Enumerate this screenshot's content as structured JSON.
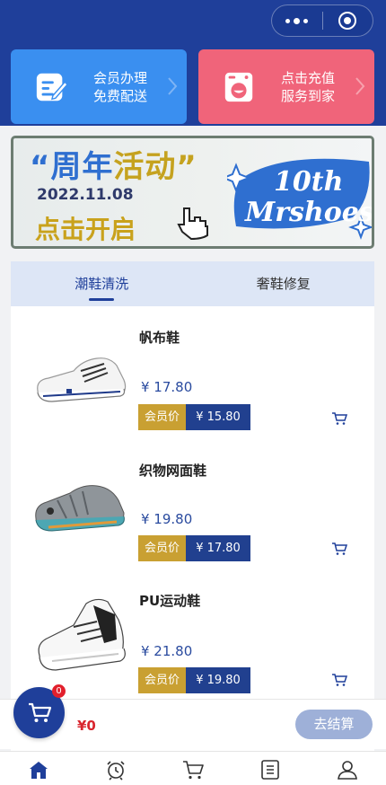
{
  "capsule": {
    "more_icon": "more-dots-icon",
    "close_icon": "mini-program-close-icon"
  },
  "services": [
    {
      "line1": "会员办理",
      "line2": "免费配送",
      "color": "#3a8ff0",
      "icon": "edit-card-icon"
    },
    {
      "line1": "点击充值",
      "line2": "服务到家",
      "color": "#f0647a",
      "icon": "washing-machine-icon"
    }
  ],
  "banner": {
    "headline_open": "“周年",
    "headline_close": "活动”",
    "date": "2022.11.08",
    "cta": "点击开启",
    "logo_line1": "10th",
    "logo_line2": "Mrshoes"
  },
  "tabs": [
    {
      "label": "潮鞋清洗",
      "active": true
    },
    {
      "label": "奢鞋修复",
      "active": false
    }
  ],
  "products": [
    {
      "name": "帆布鞋",
      "price": "¥ 17.80",
      "member_label": "会员价",
      "member_price": "¥ 15.80"
    },
    {
      "name": "织物网面鞋",
      "price": "¥ 19.80",
      "member_label": "会员价",
      "member_price": "¥ 17.80"
    },
    {
      "name": "PU运动鞋",
      "price": "¥ 21.80",
      "member_label": "会员价",
      "member_price": "¥ 19.80"
    }
  ],
  "cart": {
    "count": "0",
    "total": "¥0",
    "checkout_label": "去结算"
  },
  "tabbar": [
    {
      "icon": "home-icon",
      "active": true
    },
    {
      "icon": "alarm-clock-icon",
      "active": false
    },
    {
      "icon": "shopping-cart-icon",
      "active": false
    },
    {
      "icon": "orders-list-icon",
      "active": false
    },
    {
      "icon": "user-icon",
      "active": false
    }
  ],
  "colors": {
    "primary": "#1f3f9a",
    "gold": "#c9a032",
    "price_red": "#d9252e"
  }
}
